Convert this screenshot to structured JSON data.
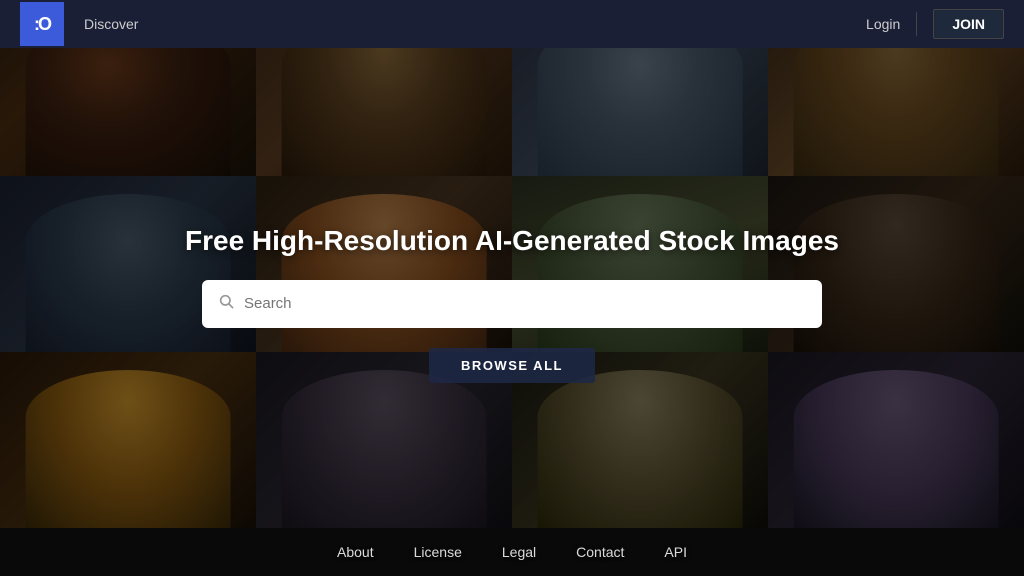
{
  "navbar": {
    "logo_symbol": ":O",
    "discover_label": "Discover",
    "login_label": "Login",
    "join_label": "JOIN"
  },
  "hero": {
    "title": "Free High-Resolution AI-Generated Stock Images",
    "search_placeholder": "Search",
    "browse_all_label": "BROWSE ALL"
  },
  "footer": {
    "links": [
      {
        "label": "About",
        "key": "about"
      },
      {
        "label": "License",
        "key": "license"
      },
      {
        "label": "Legal",
        "key": "legal"
      },
      {
        "label": "Contact",
        "key": "contact"
      },
      {
        "label": "API",
        "key": "api"
      }
    ]
  }
}
